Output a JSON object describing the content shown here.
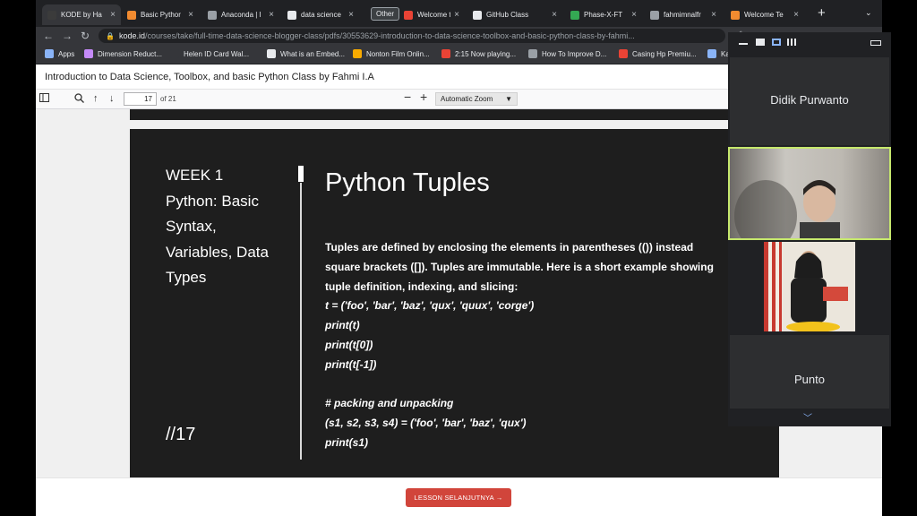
{
  "browser": {
    "tabs": [
      {
        "title": "KODE by Ha",
        "active": true,
        "icon": "kode-icon",
        "color": "#3b3b3b"
      },
      {
        "title": "Basic Pythor",
        "active": false,
        "icon": "kode-infinity-icon",
        "color": "#f28b30"
      },
      {
        "title": "Anaconda | I",
        "active": false,
        "icon": "loading-icon",
        "color": "#9aa0a6"
      },
      {
        "title": "data science",
        "active": false,
        "icon": "google-icon",
        "color": "#e8eaed"
      },
      {
        "title": "Welcome to",
        "active": false,
        "icon": "gmail-icon",
        "color": "#ea4335"
      },
      {
        "title": "GitHub Class",
        "active": false,
        "icon": "github-icon",
        "color": "#e8eaed"
      },
      {
        "title": "Phase-X-FT",
        "active": false,
        "icon": "sheets-icon",
        "color": "#34a853"
      },
      {
        "title": "fahmimnalfr",
        "active": false,
        "icon": "github-icon",
        "color": "#9aa0a6"
      },
      {
        "title": "Welcome Te",
        "active": false,
        "icon": "kode-infinity-icon",
        "color": "#f28b30"
      }
    ],
    "tab_group_label": "Other",
    "url_host": "kode.id",
    "url_path": "/courses/take/full-time-data-science-blogger-class/pdfs/30553629-introduction-to-data-science-toolbox-and-basic-python-class-by-fahmi...",
    "bookmarks": [
      {
        "label": "Apps",
        "icon": "apps-grid-icon",
        "color": "#8ab4f8"
      },
      {
        "label": "Dimension Reduct...",
        "icon": "bookmark-page-icon",
        "color": "#c58af9"
      },
      {
        "label": "Helen ID Card Wal...",
        "icon": "bookmark-page-icon",
        "color": "#35363a"
      },
      {
        "label": "What is an Embed...",
        "icon": "infinity-icon",
        "color": "#e8eaed"
      },
      {
        "label": "Nonton Film Onlin...",
        "icon": "bookmark-page-icon",
        "color": "#f9ab00"
      },
      {
        "label": "2:15 Now playing...",
        "icon": "youtube-icon",
        "color": "#ea4335"
      },
      {
        "label": "How To Improve D...",
        "icon": "bookmark-page-icon",
        "color": "#9aa0a6"
      },
      {
        "label": "Casing Hp Premiu...",
        "icon": "bookmark-page-icon",
        "color": "#ea4335"
      },
      {
        "label": "Ka",
        "icon": "bookmark-page-icon",
        "color": "#8ab4f8"
      }
    ]
  },
  "document": {
    "title": "Introduction to Data Science, Toolbox, and basic Python Class by Fahmi I.A"
  },
  "pdf_toolbar": {
    "page_current": "17",
    "page_total_label": "of 21",
    "zoom_label": "Automatic Zoom"
  },
  "slide": {
    "week_lines": [
      "WEEK 1",
      "Python: Basic",
      "Syntax,",
      "Variables, Data",
      "Types"
    ],
    "slide_number": "//17",
    "title": "Python Tuples",
    "paragraph_lines": [
      "Tuples are defined by enclosing the elements in parentheses (()) instead",
      "square brackets ([]). Tuples are immutable. Here is a short example showing",
      "tuple definition, indexing, and slicing:"
    ],
    "code_lines": [
      "t = ('foo', 'bar', 'baz', 'qux', 'quux', 'corge')",
      "print(t)",
      "print(t[0])",
      "print(t[-1])",
      "",
      "# packing and unpacking",
      "(s1, s2, s3, s4) = ('foo', 'bar', 'baz', 'qux')",
      "print(s1)"
    ]
  },
  "footer": {
    "next_lesson_label": "LESSON SELANJUTNYA →"
  },
  "call": {
    "participant_1": "Didik Purwanto",
    "participant_4": "Punto",
    "active_speaker_color": "#c6e86d"
  }
}
